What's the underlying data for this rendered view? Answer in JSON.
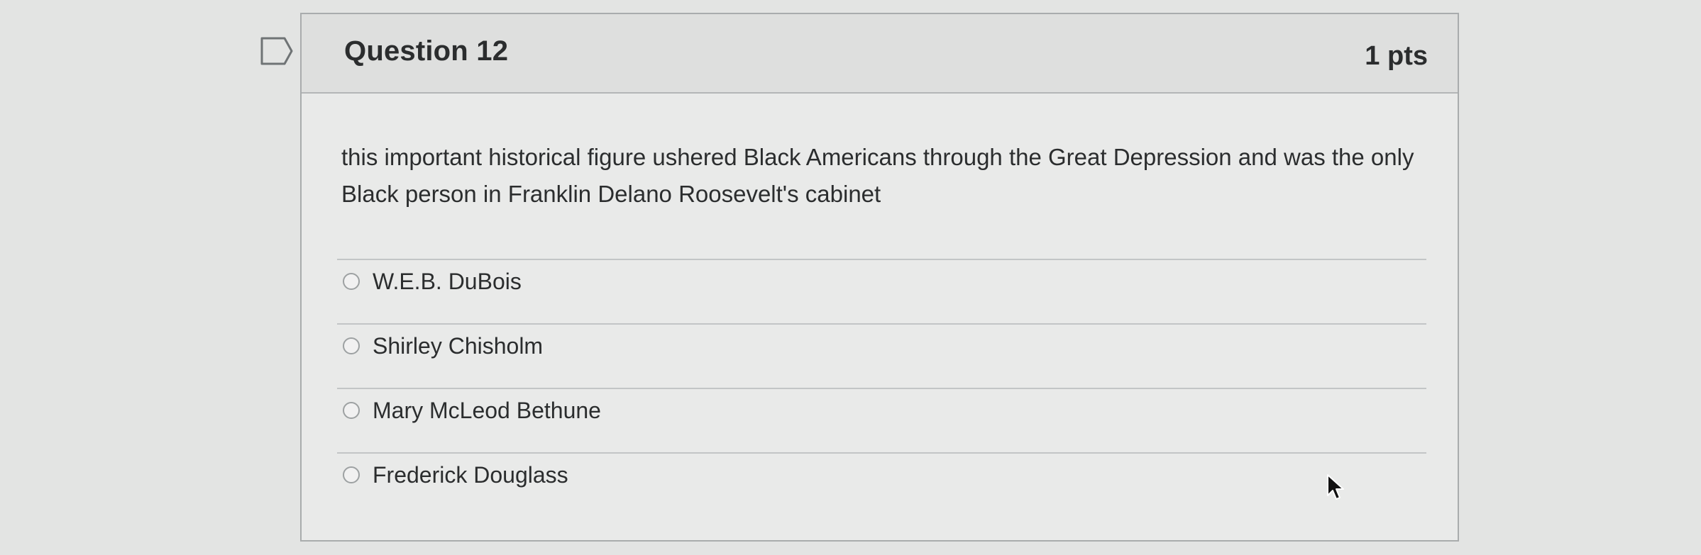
{
  "question": {
    "title": "Question 12",
    "points": "1 pts",
    "text": "this important historical figure ushered Black Americans through the Great Depression and was the only Black person in Franklin Delano Roosevelt's cabinet"
  },
  "answers": [
    {
      "label": "W.E.B. DuBois",
      "selected": false
    },
    {
      "label": "Shirley Chisholm",
      "selected": false
    },
    {
      "label": "Mary McLeod Bethune",
      "selected": false
    },
    {
      "label": "Frederick Douglass",
      "selected": false
    }
  ],
  "icons": {
    "flag": "flag-icon",
    "cursor": "mouse-pointer-icon"
  },
  "colors": {
    "background": "#e3e4e3",
    "card": "#e9eae9",
    "header": "#dedfde",
    "text": "#2b2d2e",
    "border": "#a9acad"
  }
}
